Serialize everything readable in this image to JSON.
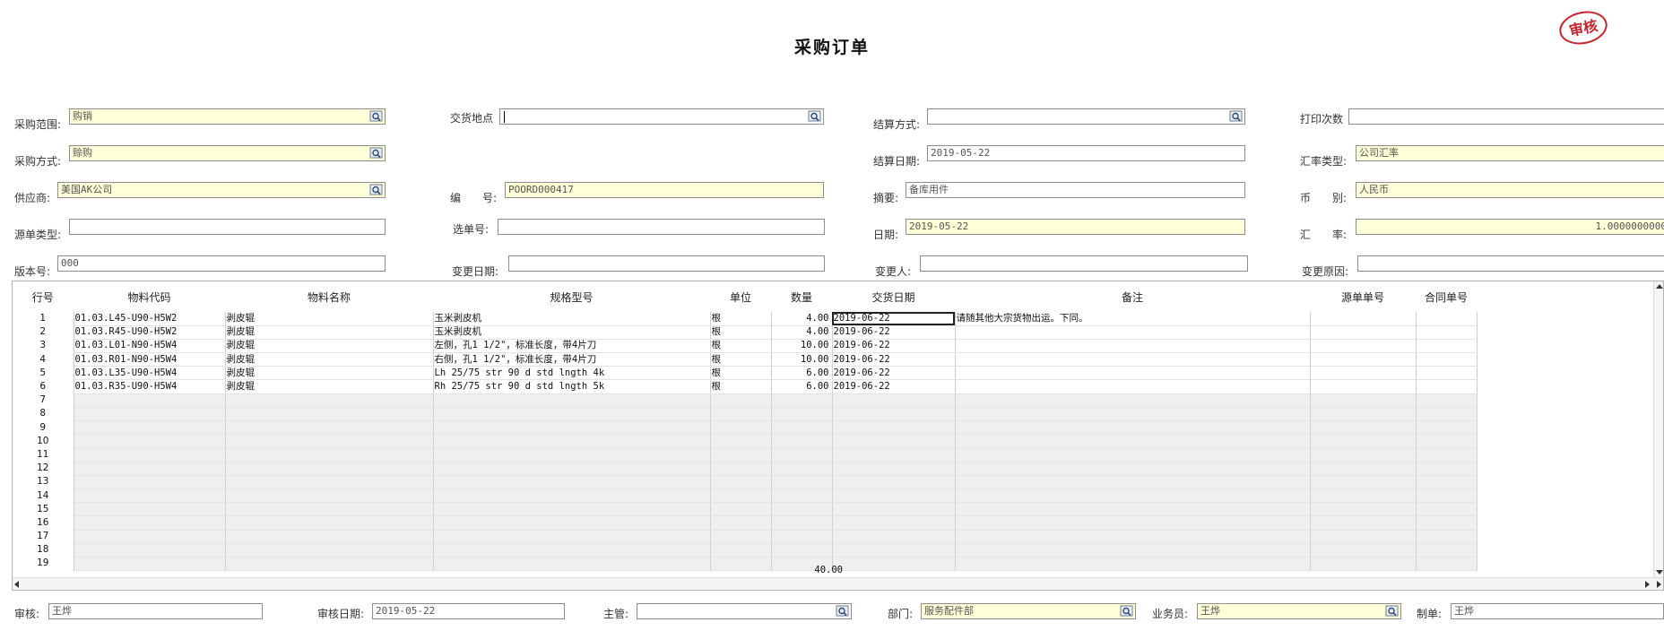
{
  "title": "采购订单",
  "stamp": "审核",
  "header": {
    "purchase_range": {
      "label": "采购范围:",
      "value": "购销"
    },
    "delivery_place": {
      "label": "交货地点",
      "value": ""
    },
    "settle_method": {
      "label": "结算方式:",
      "value": ""
    },
    "print_count": {
      "label": "打印次数",
      "value": ""
    },
    "purchase_method": {
      "label": "采购方式:",
      "value": "赊购"
    },
    "settle_date": {
      "label": "结算日期:",
      "value": "2019-05-22"
    },
    "rate_type": {
      "label": "汇率类型:",
      "value": "公司汇率"
    },
    "supplier": {
      "label": "供应商:",
      "value": "美国AK公司"
    },
    "number": {
      "label": "编　　号:",
      "value": "POORD000417"
    },
    "summary": {
      "label": "摘要:",
      "value": "备库用件"
    },
    "currency": {
      "label": "币　　别:",
      "value": "人民币"
    },
    "source_type": {
      "label": "源单类型:",
      "value": ""
    },
    "select_no": {
      "label": "选单号:",
      "value": ""
    },
    "date": {
      "label": "日期:",
      "value": "2019-05-22"
    },
    "exchange_rate": {
      "label": "汇　　率:",
      "value": "1.0000000000"
    },
    "version": {
      "label": "版本号:",
      "value": "000"
    },
    "change_date": {
      "label": "变更日期:",
      "value": ""
    },
    "changer": {
      "label": "变更人:",
      "value": ""
    },
    "change_reason": {
      "label": "变更原因:",
      "value": ""
    }
  },
  "grid": {
    "columns": [
      "行号",
      "物料代码",
      "物料名称",
      "规格型号",
      "单位",
      "数量",
      "交货日期",
      "备注",
      "源单单号",
      "合同单号"
    ],
    "rows": [
      {
        "no": "1",
        "code": "01.03.L45-U90-H5W2",
        "name": "剥皮辊",
        "spec": "玉米剥皮机",
        "unit": "根",
        "qty": "4.00",
        "date": "2019-06-22",
        "note": "请随其他大宗货物出运。下同。"
      },
      {
        "no": "2",
        "code": "01.03.R45-U90-H5W2",
        "name": "剥皮辊",
        "spec": "玉米剥皮机",
        "unit": "根",
        "qty": "4.00",
        "date": "2019-06-22",
        "note": ""
      },
      {
        "no": "3",
        "code": "01.03.L01-N90-H5W4",
        "name": "剥皮辊",
        "spec": "左侧，孔1 1/2\"，标准长度，带4片刀",
        "unit": "根",
        "qty": "10.00",
        "date": "2019-06-22",
        "note": ""
      },
      {
        "no": "4",
        "code": "01.03.R01-N90-H5W4",
        "name": "剥皮辊",
        "spec": "右侧，孔1 1/2\"，标准长度，带4片刀",
        "unit": "根",
        "qty": "10.00",
        "date": "2019-06-22",
        "note": ""
      },
      {
        "no": "5",
        "code": "01.03.L35-U90-H5W4",
        "name": "剥皮辊",
        "spec": "Lh 25/75 str 90 d std lngth 4k",
        "unit": "根",
        "qty": "6.00",
        "date": "2019-06-22",
        "note": ""
      },
      {
        "no": "6",
        "code": "01.03.R35-U90-H5W4",
        "name": "剥皮辊",
        "spec": "Rh 25/75 str 90 d std lngth 5k",
        "unit": "根",
        "qty": "6.00",
        "date": "2019-06-22",
        "note": ""
      }
    ],
    "empty_rows": [
      "7",
      "8",
      "9",
      "10",
      "11",
      "12",
      "13",
      "14",
      "15",
      "16",
      "17",
      "18",
      "19"
    ],
    "total_qty": "40.00"
  },
  "footer": {
    "auditor": {
      "label": "审核:",
      "value": "王烨"
    },
    "audit_date": {
      "label": "审核日期:",
      "value": "2019-05-22"
    },
    "manager": {
      "label": "主管:",
      "value": ""
    },
    "department": {
      "label": "部门:",
      "value": "服务配件部"
    },
    "salesman": {
      "label": "业务员:",
      "value": "王烨"
    },
    "maker": {
      "label": "制单:",
      "value": "王烨"
    }
  },
  "colors": {
    "required_bg": "#ffffd8",
    "stamp": "#c8232c",
    "grid_empty": "#efefef"
  }
}
